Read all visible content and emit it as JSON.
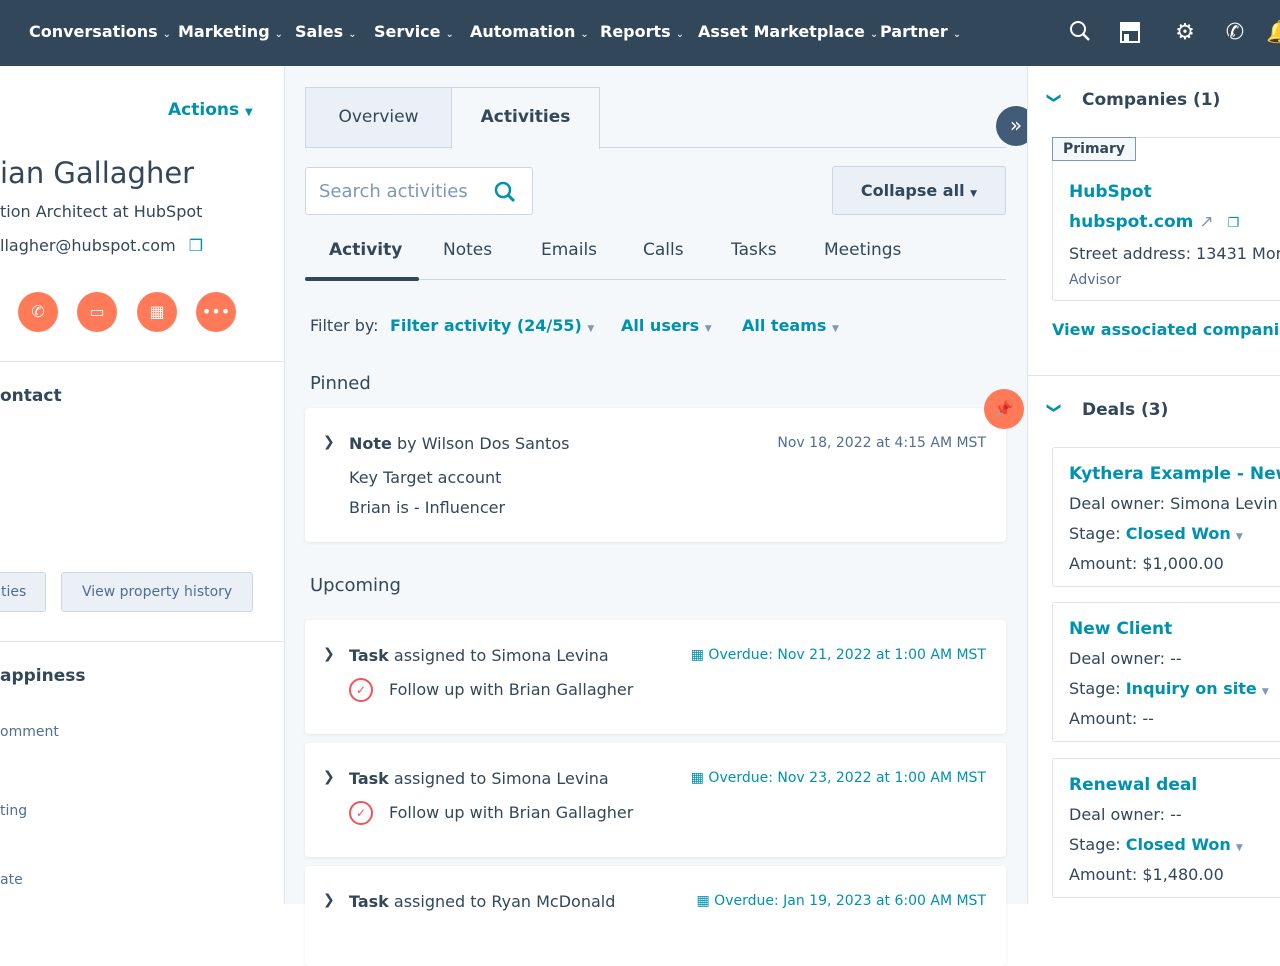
{
  "nav": {
    "items": [
      "Conversations",
      "Marketing",
      "Sales",
      "Service",
      "Automation",
      "Reports",
      "Asset Marketplace",
      "Partner"
    ],
    "icons": [
      "search-icon",
      "marketplace-icon",
      "gear-icon",
      "phone-icon",
      "bell-icon"
    ]
  },
  "left": {
    "actions": "Actions",
    "name": "ian Gallagher",
    "title": "tion Architect at HubSpot",
    "email": "llagher@hubspot.com",
    "section1": "ontact",
    "btn1": "ties",
    "btn2": "View property history",
    "section2": "appiness",
    "fields": [
      "omment",
      "ting",
      "ate"
    ]
  },
  "mid": {
    "tabs": [
      "Overview",
      "Activities"
    ],
    "search_placeholder": "Search activities",
    "collapse": "Collapse all",
    "subtabs": [
      "Activity",
      "Notes",
      "Emails",
      "Calls",
      "Tasks",
      "Meetings"
    ],
    "filter_label": "Filter by:",
    "filter_activity": "Filter activity (24/55)",
    "all_users": "All users",
    "all_teams": "All teams",
    "pinned": "Pinned",
    "upcoming": "Upcoming",
    "note": {
      "type": "Note",
      "by": "by Wilson Dos Santos",
      "date": "Nov 18, 2022 at 4:15 AM MST",
      "lines": [
        "Key Target account",
        "Brian is - Influencer"
      ]
    },
    "tasks": [
      {
        "type": "Task",
        "who": "assigned to Simona Levina",
        "due": "Overdue: Nov 21, 2022 at 1:00 AM MST",
        "text": "Follow up with Brian Gallagher"
      },
      {
        "type": "Task",
        "who": "assigned to Simona Levina",
        "due": "Overdue: Nov 23, 2022 at 1:00 AM MST",
        "text": "Follow up with Brian Gallagher"
      },
      {
        "type": "Task",
        "who": "assigned to Ryan McDonald",
        "due": "Overdue: Jan 19, 2023 at 6:00 AM MST"
      }
    ]
  },
  "right": {
    "companies": "Companies (1)",
    "primary": "Primary",
    "company": "HubSpot",
    "domain": "hubspot.com",
    "street_label": "Street address:",
    "street": "13431 Mor",
    "role": "Advisor",
    "view_assoc": "View associated companie",
    "deals": "Deals (3)",
    "deal_list": [
      {
        "name": "Kythera Example - New I",
        "owner_label": "Deal owner:",
        "owner": "Simona Levin",
        "stage_label": "Stage:",
        "stage": "Closed Won",
        "amount_label": "Amount:",
        "amount": "$1,000.00"
      },
      {
        "name": "New Client",
        "owner_label": "Deal owner:",
        "owner": "--",
        "stage_label": "Stage:",
        "stage": "Inquiry on site",
        "amount_label": "Amount:",
        "amount": "--"
      },
      {
        "name": "Renewal deal",
        "owner_label": "Deal owner:",
        "owner": "--",
        "stage_label": "Stage:",
        "stage": "Closed Won",
        "amount_label": "Amount:",
        "amount": "$1,480.00"
      }
    ]
  },
  "colors": {
    "nav": "#33475b",
    "accent": "#0091ae",
    "orange": "#ff7a59",
    "task_circle": "#f2545b"
  }
}
